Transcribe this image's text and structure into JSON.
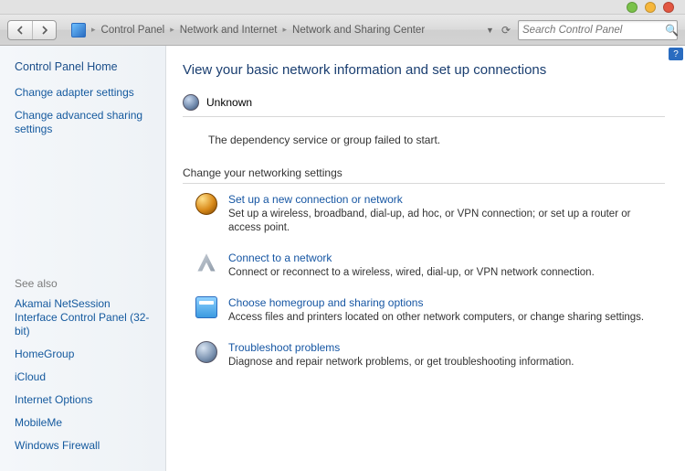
{
  "window": {
    "help_tooltip": "?"
  },
  "breadcrumb": {
    "items": [
      "Control Panel",
      "Network and Internet",
      "Network and Sharing Center"
    ]
  },
  "search": {
    "placeholder": "Search Control Panel"
  },
  "sidebar": {
    "home": "Control Panel Home",
    "links": [
      "Change adapter settings",
      "Change advanced sharing settings"
    ],
    "seealso_header": "See also",
    "seealso": [
      "Akamai NetSession Interface Control Panel (32-bit)",
      "HomeGroup",
      "iCloud",
      "Internet Options",
      "MobileMe",
      "Windows Firewall"
    ]
  },
  "main": {
    "title": "View your basic network information and set up connections",
    "status_label": "Unknown",
    "error_message": "The dependency service or group failed to start.",
    "section_header": "Change your networking settings",
    "options": [
      {
        "title": "Set up a new connection or network",
        "desc": "Set up a wireless, broadband, dial-up, ad hoc, or VPN connection; or set up a router or access point."
      },
      {
        "title": "Connect to a network",
        "desc": "Connect or reconnect to a wireless, wired, dial-up, or VPN network connection."
      },
      {
        "title": "Choose homegroup and sharing options",
        "desc": "Access files and printers located on other network computers, or change sharing settings."
      },
      {
        "title": "Troubleshoot problems",
        "desc": "Diagnose and repair network problems, or get troubleshooting information."
      }
    ]
  }
}
